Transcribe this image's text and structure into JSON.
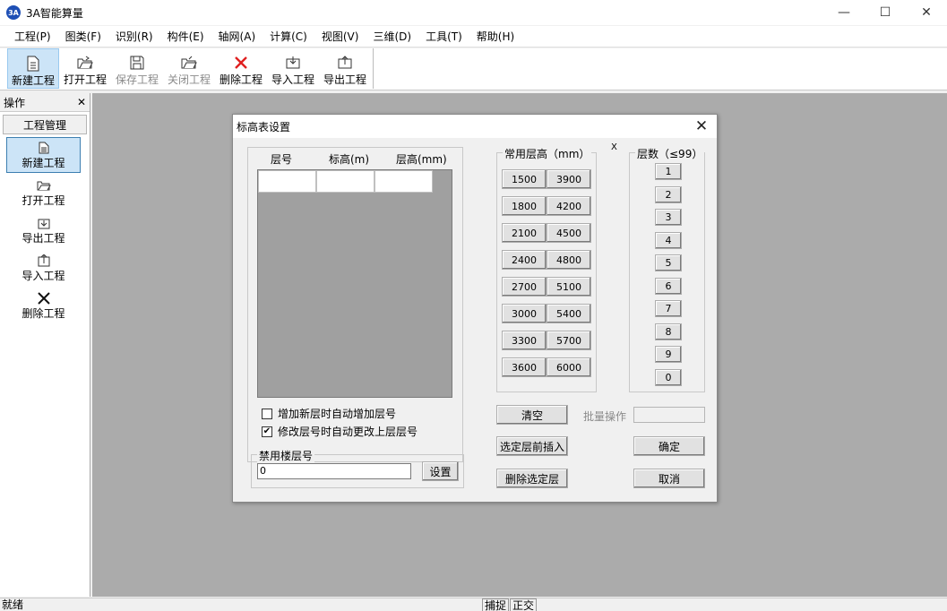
{
  "app": {
    "icon_text": "3A",
    "title": "3A智能算量",
    "minimize": "—",
    "maximize": "☐",
    "close": "✕"
  },
  "menu": [
    "工程(P)",
    "图类(F)",
    "识别(R)",
    "构件(E)",
    "轴网(A)",
    "计算(C)",
    "视图(V)",
    "三维(D)",
    "工具(T)",
    "帮助(H)"
  ],
  "toolbar": {
    "new": "新建工程",
    "open": "打开工程",
    "save": "保存工程",
    "close": "关闭工程",
    "delete": "删除工程",
    "import": "导入工程",
    "export": "导出工程"
  },
  "left_panel": {
    "title": "操作",
    "close": "✕",
    "tab": "工程管理",
    "items": {
      "new": "新建工程",
      "open": "打开工程",
      "export": "导出工程",
      "import": "导入工程",
      "delete": "删除工程"
    }
  },
  "status": {
    "text": "就绪",
    "snap": "捕捉",
    "ortho": "正交"
  },
  "dialog": {
    "title": "标高表设置",
    "close": "✕",
    "columns": [
      "层号",
      "标高(m)",
      "层高(mm)"
    ],
    "auto_add_label": "增加新层时自动增加层号",
    "auto_add_checked": false,
    "auto_update_label": "修改层号时自动更改上层层号",
    "auto_update_checked": true,
    "disabled_group_label": "禁用楼层号",
    "disabled_value": "0",
    "set_button": "设置",
    "common_heights_label": "常用层高（mm）",
    "heights": [
      "1500",
      "3900",
      "1800",
      "4200",
      "2100",
      "4500",
      "2400",
      "4800",
      "2700",
      "5100",
      "3000",
      "5400",
      "3300",
      "5700",
      "3600",
      "6000"
    ],
    "x_mark": "X",
    "floors_label": "层数（≤99）",
    "digits": [
      "1",
      "2",
      "3",
      "4",
      "5",
      "6",
      "7",
      "8",
      "9",
      "0"
    ],
    "clear_button": "清空",
    "batch_label": "批量操作",
    "batch_value": "",
    "insert_button": "选定层前插入",
    "delete_button": "删除选定层",
    "ok_button": "确定",
    "cancel_button": "取消"
  }
}
